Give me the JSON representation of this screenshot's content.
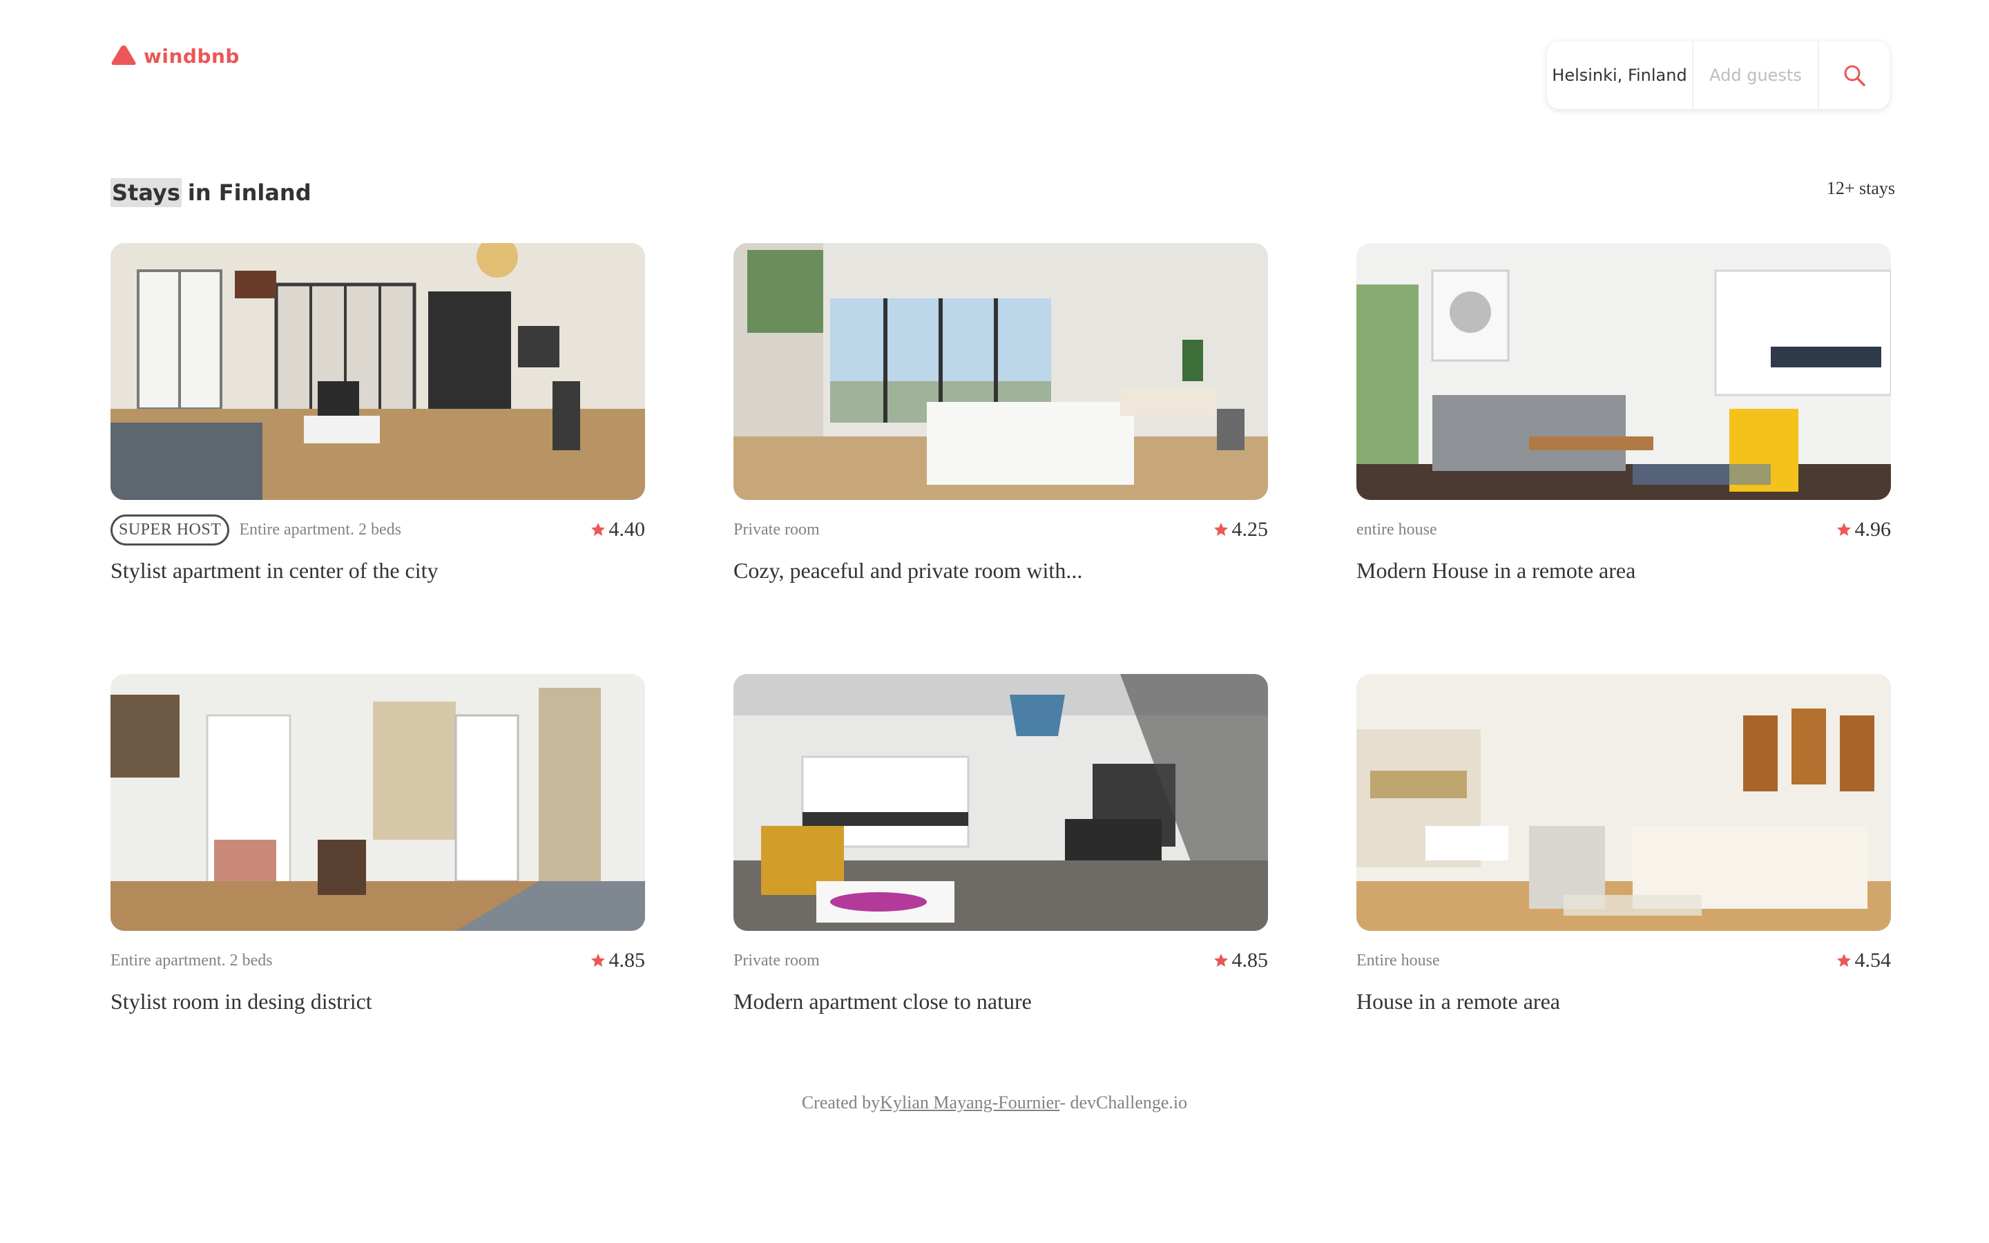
{
  "brand": {
    "name": "windbnb",
    "color": "#EB5757",
    "icon": "logo-icon"
  },
  "search": {
    "location": "Helsinki, Finland",
    "guests_placeholder": "Add guests",
    "button_icon": "search-icon"
  },
  "section": {
    "title_word1": "Stays",
    "title_word2": "in Finland",
    "count": "12+ stays"
  },
  "stays": [
    {
      "superhost_label": "SUPER HOST",
      "type": "Entire apartment. 2 beds",
      "rating": "4.40",
      "title": "Stylist apartment in center of the city"
    },
    {
      "type": "Private room",
      "rating": "4.25",
      "title": "Cozy, peaceful and private room with..."
    },
    {
      "type": "entire house",
      "rating": "4.96",
      "title": "Modern House in a remote area"
    },
    {
      "type": "Entire apartment. 2 beds",
      "rating": "4.85",
      "title": "Stylist room in desing district"
    },
    {
      "type": "Private room",
      "rating": "4.85",
      "title": "Modern apartment close to nature"
    },
    {
      "type": "Entire house",
      "rating": "4.54",
      "title": "House in a remote area"
    }
  ],
  "footer": {
    "prefix": "Created by",
    "author": "Kylian Mayang-Fournier",
    "suffix": "- devChallenge.io"
  }
}
